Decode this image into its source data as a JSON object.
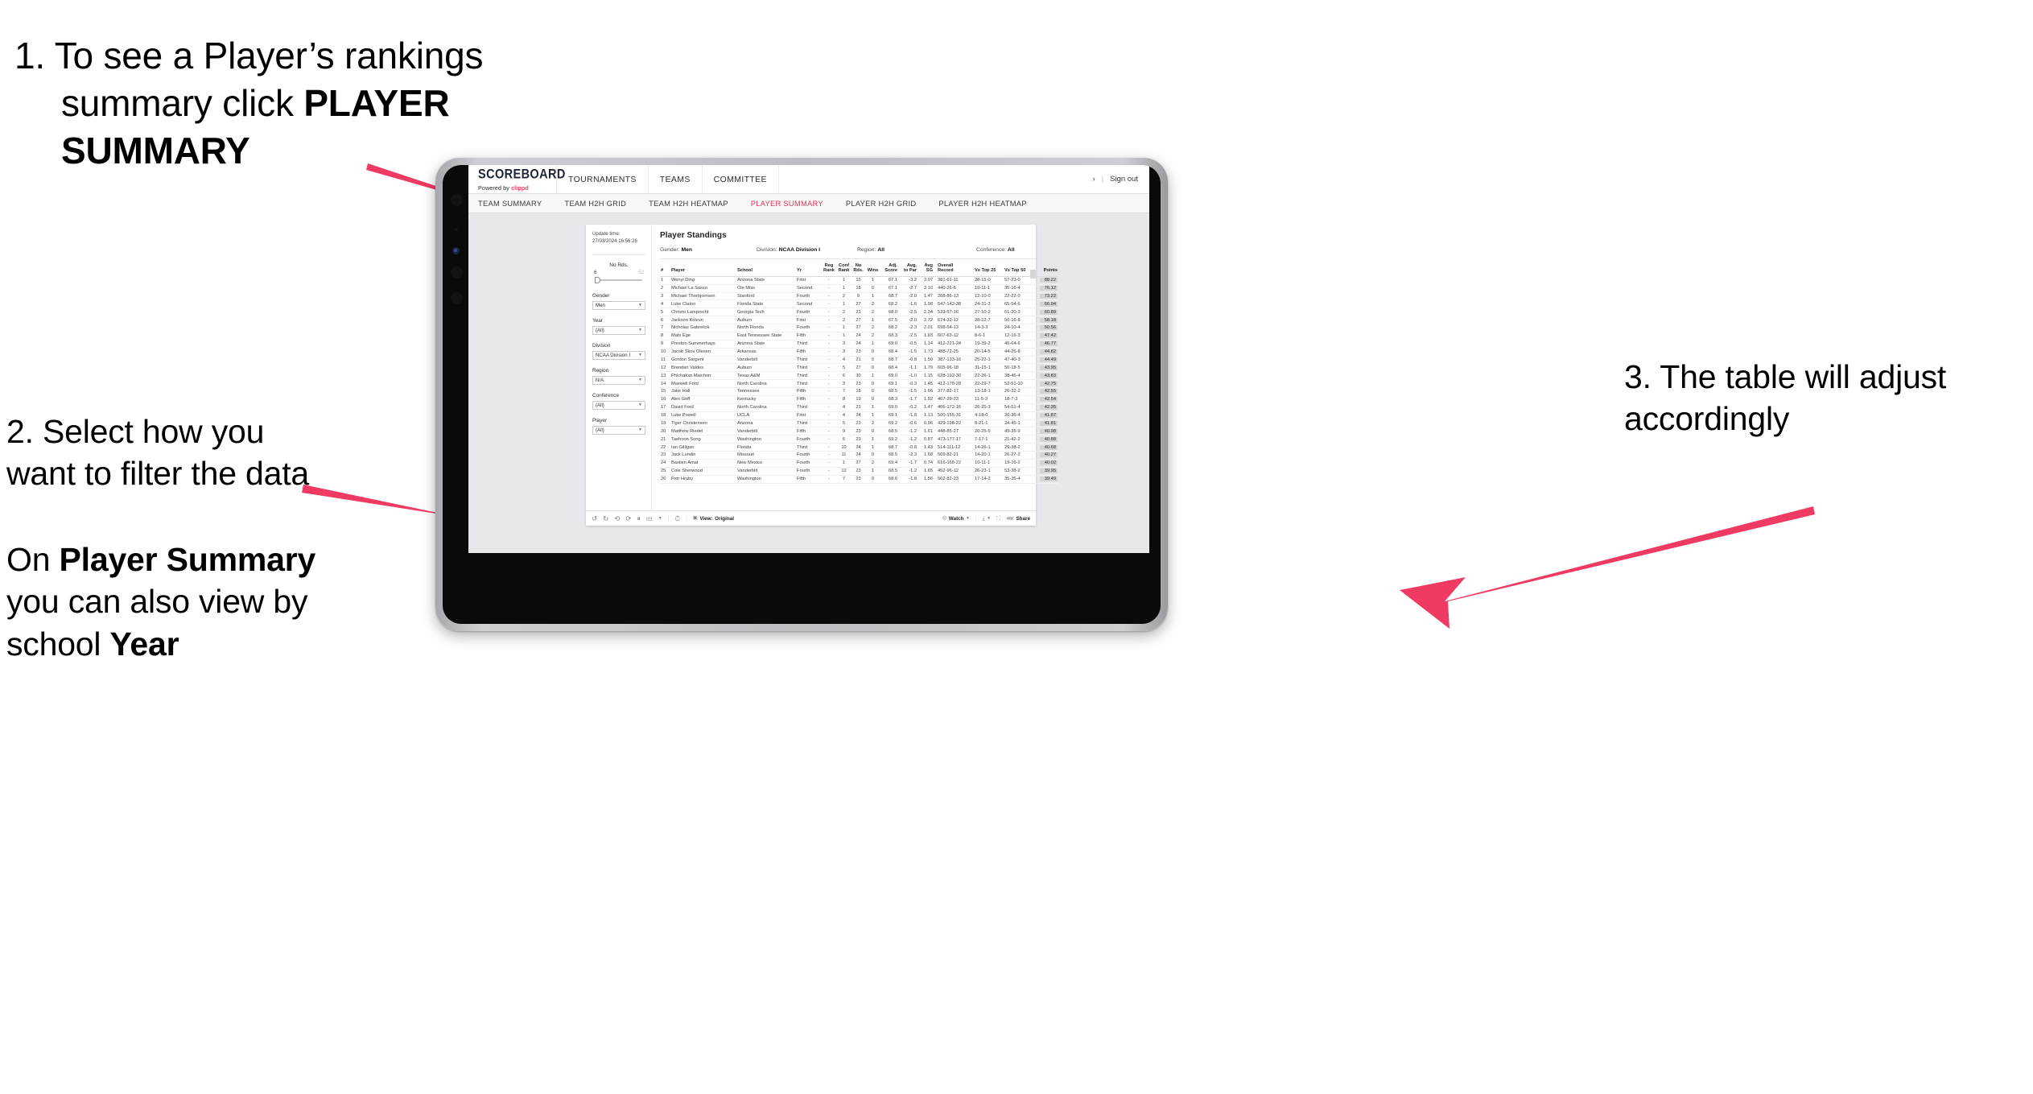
{
  "annotations": {
    "a1": {
      "number": "1.",
      "line1": "To see a Player’s rankings",
      "line2_plain": "summary click ",
      "line2_bold": "PLAYER",
      "line3_bold": "SUMMARY"
    },
    "a2": {
      "p1": "2. Select how you want to filter the data",
      "p2_pre": "On ",
      "p2_bold1": "Player Summary",
      "p2_mid": " you can also view by school ",
      "p2_bold2": "Year"
    },
    "a3": {
      "text": "3. The table will adjust accordingly"
    },
    "arrow_color": "#ef3b63"
  },
  "app": {
    "brand": {
      "name": "SCOREBOARD",
      "powered_pre": "Powered by ",
      "powered_brand": "clippd"
    },
    "topnav": [
      "TOURNAMENTS",
      "TEAMS",
      "COMMITTEE"
    ],
    "topright": {
      "truncated": "›",
      "separator": "|",
      "signout": "Sign out"
    },
    "subnav": [
      {
        "label": "TEAM SUMMARY",
        "active": false
      },
      {
        "label": "TEAM H2H GRID",
        "active": false
      },
      {
        "label": "TEAM H2H HEATMAP",
        "active": false
      },
      {
        "label": "PLAYER SUMMARY",
        "active": true
      },
      {
        "label": "PLAYER H2H GRID",
        "active": false
      },
      {
        "label": "PLAYER H2H HEATMAP",
        "active": false
      }
    ],
    "active_tab_color": "#e8325c"
  },
  "filters": {
    "update_time_label": "Update time:",
    "update_time_value": "27/03/2024 16:56:26",
    "slider": {
      "label": "No Rds.",
      "min": "6",
      "max": "52",
      "value": 6
    },
    "selects": [
      {
        "label": "Gender",
        "value": "Men"
      },
      {
        "label": "Year",
        "value": "(All)"
      },
      {
        "label": "Division",
        "value": "NCAA Division I"
      },
      {
        "label": "Region",
        "value": "N/A"
      },
      {
        "label": "Conference",
        "value": "(All)"
      },
      {
        "label": "Player",
        "value": "(All)"
      }
    ]
  },
  "viz": {
    "title": "Player Standings",
    "subheader": [
      {
        "label": "Gender:",
        "value": "Men"
      },
      {
        "label": "Division:",
        "value": "NCAA Division I"
      },
      {
        "label": "Region:",
        "value": "All"
      },
      {
        "label": "Conference:",
        "value": "All"
      }
    ],
    "columns": [
      {
        "key": "num",
        "l1": "#",
        "l2": ""
      },
      {
        "key": "player",
        "l1": "Player",
        "l2": ""
      },
      {
        "key": "school",
        "l1": "School",
        "l2": ""
      },
      {
        "key": "yr",
        "l1": "Yr",
        "l2": ""
      },
      {
        "key": "reg",
        "l1": "Reg",
        "l2": "Rank"
      },
      {
        "key": "conf",
        "l1": "Conf",
        "l2": "Rank"
      },
      {
        "key": "nords",
        "l1": "No",
        "l2": "Rds."
      },
      {
        "key": "wins",
        "l1": "",
        "l2": "Wins"
      },
      {
        "key": "adj",
        "l1": "Adj.",
        "l2": "Score"
      },
      {
        "key": "par",
        "l1": "Avg.",
        "l2": "to Par"
      },
      {
        "key": "sg",
        "l1": "Avg",
        "l2": "SG"
      },
      {
        "key": "rec",
        "l1": "Overall",
        "l2": "Record"
      },
      {
        "key": "t25",
        "l1": "",
        "l2": "Vs Top 25"
      },
      {
        "key": "t50",
        "l1": "",
        "l2": "Vs Top 50"
      },
      {
        "key": "pts",
        "l1": "",
        "l2": "Points"
      }
    ],
    "rows": [
      [
        "1",
        "Wenyi Ding",
        "Arizona State",
        "First",
        "-",
        "1",
        "15",
        "1",
        "67.1",
        "-3.2",
        "3.07",
        "381-61-11",
        "28-15-0",
        "57-23-0",
        "88.22"
      ],
      [
        "2",
        "Michael La Sasso",
        "Ole Miss",
        "Second",
        "-",
        "1",
        "18",
        "0",
        "67.1",
        "-2.7",
        "3.10",
        "440-26-6",
        "19-11-1",
        "35-16-4",
        "76.12"
      ],
      [
        "3",
        "Michael Thorbjornsen",
        "Stanford",
        "Fourth",
        "-",
        "2",
        "9",
        "1",
        "68.7",
        "-2.0",
        "1.47",
        "208-86-13",
        "12-10-0",
        "22-22-0",
        "73.22"
      ],
      [
        "4",
        "Luke Claton",
        "Florida State",
        "Second",
        "-",
        "1",
        "27",
        "2",
        "68.2",
        "-1.6",
        "1.98",
        "547-142-38",
        "24-31-3",
        "65-54-6",
        "66.94"
      ],
      [
        "5",
        "Christo Lamprecht",
        "Georgia Tech",
        "Fourth",
        "-",
        "2",
        "21",
        "2",
        "68.0",
        "-2.5",
        "2.34",
        "533-57-16",
        "27-10-2",
        "61-20-3",
        "60.89"
      ],
      [
        "6",
        "Jackson Koivun",
        "Auburn",
        "First",
        "-",
        "2",
        "27",
        "1",
        "67.5",
        "-2.0",
        "2.72",
        "674-33-12",
        "28-12-7",
        "50-16-8",
        "58.18"
      ],
      [
        "7",
        "Nicholas Gabrelcik",
        "North Florida",
        "Fourth",
        "-",
        "1",
        "27",
        "2",
        "68.2",
        "-2.3",
        "2.01",
        "698-54-13",
        "14-3-3",
        "24-10-4",
        "50.56"
      ],
      [
        "8",
        "Mats Ege",
        "East Tennessee State",
        "Fifth",
        "-",
        "1",
        "24",
        "2",
        "68.3",
        "-2.5",
        "1.93",
        "607-63-12",
        "8-6-1",
        "12-16-3",
        "47.42"
      ],
      [
        "9",
        "Preston Summerhays",
        "Arizona State",
        "Third",
        "-",
        "3",
        "24",
        "1",
        "69.0",
        "-0.5",
        "1.14",
        "412-221-24",
        "19-39-2",
        "46-64-6",
        "46.77"
      ],
      [
        "10",
        "Jacob Skov Olesen",
        "Arkansas",
        "Fifth",
        "-",
        "3",
        "23",
        "0",
        "68.4",
        "-1.5",
        "1.73",
        "488-72-25",
        "20-14-5",
        "44-26-8",
        "44.82"
      ],
      [
        "11",
        "Gordon Sargent",
        "Vanderbilt",
        "Third",
        "-",
        "4",
        "21",
        "0",
        "68.7",
        "-0.8",
        "1.50",
        "387-133-16",
        "25-22-1",
        "47-40-3",
        "44.49"
      ],
      [
        "12",
        "Brendan Valdes",
        "Auburn",
        "Third",
        "-",
        "5",
        "27",
        "0",
        "68.4",
        "-1.1",
        "1.79",
        "605-96-18",
        "31-15-1",
        "50-18-5",
        "43.95"
      ],
      [
        "13",
        "Phichaksn Maichon",
        "Texas A&M",
        "Third",
        "-",
        "6",
        "30",
        "1",
        "69.0",
        "-1.0",
        "1.15",
        "628-192-30",
        "22-26-1",
        "38-46-4",
        "43.83"
      ],
      [
        "14",
        "Maxwell Ford",
        "North Carolina",
        "Third",
        "-",
        "3",
        "23",
        "0",
        "69.1",
        "-0.3",
        "1.45",
        "412-178-28",
        "22-29-7",
        "52-51-10",
        "42.75"
      ],
      [
        "15",
        "Jake Hall",
        "Tennessee",
        "Fifth",
        "-",
        "7",
        "18",
        "0",
        "68.5",
        "-1.5",
        "1.66",
        "377-82-17",
        "13-18-1",
        "26-32-2",
        "42.55"
      ],
      [
        "16",
        "Alex Goff",
        "Kentucky",
        "Fifth",
        "-",
        "8",
        "19",
        "0",
        "68.3",
        "-1.7",
        "1.92",
        "467-29-23",
        "11-5-3",
        "18-7-3",
        "42.54"
      ],
      [
        "17",
        "David Ford",
        "North Carolina",
        "Third",
        "-",
        "4",
        "21",
        "1",
        "69.0",
        "-0.2",
        "1.47",
        "406-172-16",
        "26-25-3",
        "54-51-4",
        "42.35"
      ],
      [
        "18",
        "Luke Powell",
        "UCLA",
        "First",
        "-",
        "4",
        "24",
        "1",
        "69.1",
        "-1.8",
        "1.13",
        "500-155-31",
        "4-18-0",
        "20-36-4",
        "41.87"
      ],
      [
        "19",
        "Tiger Christensen",
        "Arizona",
        "Third",
        "-",
        "5",
        "23",
        "2",
        "69.2",
        "-0.6",
        "0.96",
        "429-198-22",
        "8-21-1",
        "24-45-1",
        "41.81"
      ],
      [
        "20",
        "Matthew Riedel",
        "Vanderbilt",
        "Fifth",
        "-",
        "9",
        "23",
        "0",
        "68.5",
        "-1.2",
        "1.61",
        "448-85-27",
        "20-25-5",
        "49-35-9",
        "40.98"
      ],
      [
        "21",
        "Taehoon Song",
        "Washington",
        "Fourth",
        "-",
        "6",
        "23",
        "1",
        "69.2",
        "-1.2",
        "0.87",
        "473-177-17",
        "7-17-1",
        "21-42-2",
        "40.88"
      ],
      [
        "22",
        "Ian Gilligan",
        "Florida",
        "Third",
        "-",
        "10",
        "24",
        "1",
        "68.7",
        "-0.8",
        "1.43",
        "514-111-12",
        "14-26-1",
        "29-38-2",
        "40.68"
      ],
      [
        "23",
        "Jack Lundin",
        "Missouri",
        "Fourth",
        "-",
        "11",
        "24",
        "0",
        "68.5",
        "-2.3",
        "1.68",
        "509-82-21",
        "14-20-1",
        "26-27-2",
        "40.27"
      ],
      [
        "24",
        "Bastien Amat",
        "New Mexico",
        "Fourth",
        "-",
        "1",
        "27",
        "2",
        "69.4",
        "-1.7",
        "0.74",
        "616-168-22",
        "10-11-1",
        "19-16-2",
        "40.02"
      ],
      [
        "25",
        "Cole Sherwood",
        "Vanderbilt",
        "Fourth",
        "-",
        "12",
        "23",
        "1",
        "68.5",
        "-1.2",
        "1.65",
        "452-96-12",
        "26-23-1",
        "53-38-2",
        "39.95"
      ],
      [
        "26",
        "Petr Hruby",
        "Washington",
        "Fifth",
        "-",
        "7",
        "23",
        "0",
        "68.6",
        "-1.8",
        "1.56",
        "562-82-23",
        "17-14-2",
        "35-26-4",
        "39.49"
      ]
    ]
  },
  "toolbar": {
    "icons": [
      "undo-icon",
      "redo-icon",
      "revert-icon",
      "refresh-data-icon",
      "pause-updates-icon",
      "custom-view-icon",
      "dropdown-caret-icon",
      "alert-icon"
    ],
    "view_label": "View:",
    "view_value": "Original",
    "watch_label": "Watch",
    "share_label": "Share"
  }
}
